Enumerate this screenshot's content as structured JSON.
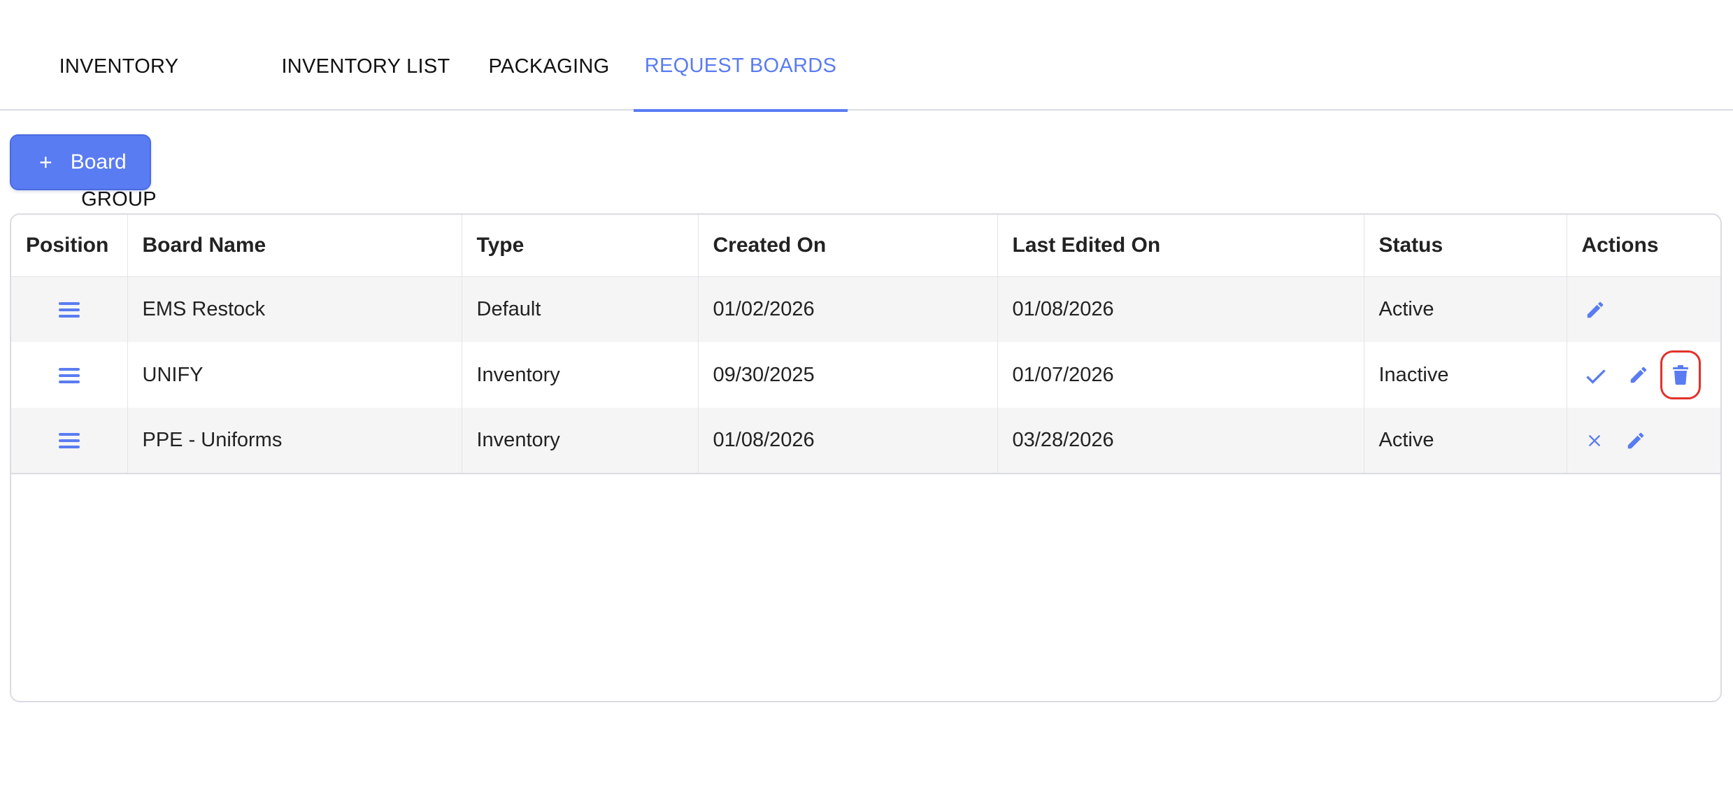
{
  "tabs": [
    {
      "label": "INVENTORY GROUP",
      "active": false
    },
    {
      "label": "INVENTORY LIST",
      "active": false
    },
    {
      "label": "PACKAGING",
      "active": false
    },
    {
      "label": "REQUEST BOARDS",
      "active": true
    }
  ],
  "toolbar": {
    "add_icon": "+",
    "add_label": "Board"
  },
  "table": {
    "columns": [
      "Position",
      "Board Name",
      "Type",
      "Created On",
      "Last Edited On",
      "Status",
      "Actions"
    ],
    "rows": [
      {
        "name": "EMS Restock",
        "type": "Default",
        "created_on": "01/02/2026",
        "last_edited_on": "01/08/2026",
        "status": "Active",
        "actions": [
          "edit-icon"
        ]
      },
      {
        "name": "UNIFY",
        "type": "Inventory",
        "created_on": "09/30/2025",
        "last_edited_on": "01/07/2026",
        "status": "Inactive",
        "actions": [
          "check-icon",
          "edit-icon",
          "trash-icon"
        ]
      },
      {
        "name": "PPE - Uniforms",
        "type": "Inventory",
        "created_on": "01/08/2026",
        "last_edited_on": "03/28/2026",
        "status": "Active",
        "actions": [
          "close-icon",
          "edit-icon"
        ]
      }
    ]
  },
  "colors": {
    "accent": "#5a7cf2",
    "highlight_outline": "#e0332a",
    "row_stripe": "#f5f5f5"
  }
}
